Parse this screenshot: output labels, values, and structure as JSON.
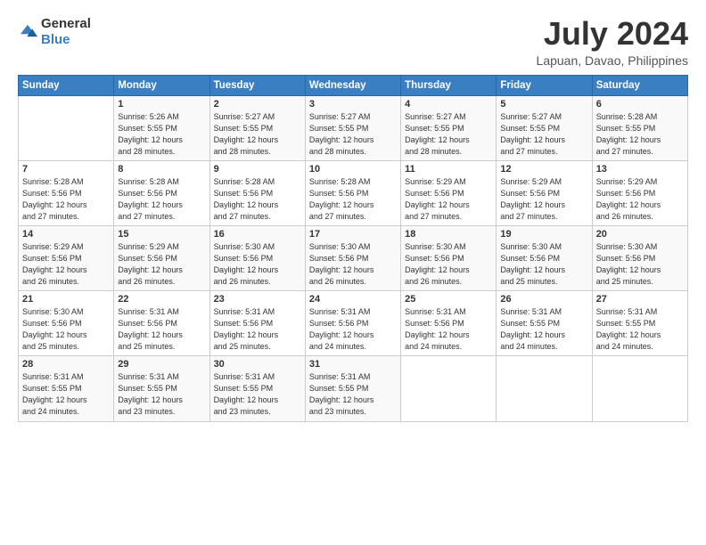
{
  "logo": {
    "general": "General",
    "blue": "Blue"
  },
  "header": {
    "month_year": "July 2024",
    "location": "Lapuan, Davao, Philippines"
  },
  "days_of_week": [
    "Sunday",
    "Monday",
    "Tuesday",
    "Wednesday",
    "Thursday",
    "Friday",
    "Saturday"
  ],
  "weeks": [
    [
      {
        "day": "",
        "info": ""
      },
      {
        "day": "1",
        "info": "Sunrise: 5:26 AM\nSunset: 5:55 PM\nDaylight: 12 hours\nand 28 minutes."
      },
      {
        "day": "2",
        "info": "Sunrise: 5:27 AM\nSunset: 5:55 PM\nDaylight: 12 hours\nand 28 minutes."
      },
      {
        "day": "3",
        "info": "Sunrise: 5:27 AM\nSunset: 5:55 PM\nDaylight: 12 hours\nand 28 minutes."
      },
      {
        "day": "4",
        "info": "Sunrise: 5:27 AM\nSunset: 5:55 PM\nDaylight: 12 hours\nand 28 minutes."
      },
      {
        "day": "5",
        "info": "Sunrise: 5:27 AM\nSunset: 5:55 PM\nDaylight: 12 hours\nand 27 minutes."
      },
      {
        "day": "6",
        "info": "Sunrise: 5:28 AM\nSunset: 5:55 PM\nDaylight: 12 hours\nand 27 minutes."
      }
    ],
    [
      {
        "day": "7",
        "info": "Sunrise: 5:28 AM\nSunset: 5:56 PM\nDaylight: 12 hours\nand 27 minutes."
      },
      {
        "day": "8",
        "info": "Sunrise: 5:28 AM\nSunset: 5:56 PM\nDaylight: 12 hours\nand 27 minutes."
      },
      {
        "day": "9",
        "info": "Sunrise: 5:28 AM\nSunset: 5:56 PM\nDaylight: 12 hours\nand 27 minutes."
      },
      {
        "day": "10",
        "info": "Sunrise: 5:28 AM\nSunset: 5:56 PM\nDaylight: 12 hours\nand 27 minutes."
      },
      {
        "day": "11",
        "info": "Sunrise: 5:29 AM\nSunset: 5:56 PM\nDaylight: 12 hours\nand 27 minutes."
      },
      {
        "day": "12",
        "info": "Sunrise: 5:29 AM\nSunset: 5:56 PM\nDaylight: 12 hours\nand 27 minutes."
      },
      {
        "day": "13",
        "info": "Sunrise: 5:29 AM\nSunset: 5:56 PM\nDaylight: 12 hours\nand 26 minutes."
      }
    ],
    [
      {
        "day": "14",
        "info": "Sunrise: 5:29 AM\nSunset: 5:56 PM\nDaylight: 12 hours\nand 26 minutes."
      },
      {
        "day": "15",
        "info": "Sunrise: 5:29 AM\nSunset: 5:56 PM\nDaylight: 12 hours\nand 26 minutes."
      },
      {
        "day": "16",
        "info": "Sunrise: 5:30 AM\nSunset: 5:56 PM\nDaylight: 12 hours\nand 26 minutes."
      },
      {
        "day": "17",
        "info": "Sunrise: 5:30 AM\nSunset: 5:56 PM\nDaylight: 12 hours\nand 26 minutes."
      },
      {
        "day": "18",
        "info": "Sunrise: 5:30 AM\nSunset: 5:56 PM\nDaylight: 12 hours\nand 26 minutes."
      },
      {
        "day": "19",
        "info": "Sunrise: 5:30 AM\nSunset: 5:56 PM\nDaylight: 12 hours\nand 25 minutes."
      },
      {
        "day": "20",
        "info": "Sunrise: 5:30 AM\nSunset: 5:56 PM\nDaylight: 12 hours\nand 25 minutes."
      }
    ],
    [
      {
        "day": "21",
        "info": "Sunrise: 5:30 AM\nSunset: 5:56 PM\nDaylight: 12 hours\nand 25 minutes."
      },
      {
        "day": "22",
        "info": "Sunrise: 5:31 AM\nSunset: 5:56 PM\nDaylight: 12 hours\nand 25 minutes."
      },
      {
        "day": "23",
        "info": "Sunrise: 5:31 AM\nSunset: 5:56 PM\nDaylight: 12 hours\nand 25 minutes."
      },
      {
        "day": "24",
        "info": "Sunrise: 5:31 AM\nSunset: 5:56 PM\nDaylight: 12 hours\nand 24 minutes."
      },
      {
        "day": "25",
        "info": "Sunrise: 5:31 AM\nSunset: 5:56 PM\nDaylight: 12 hours\nand 24 minutes."
      },
      {
        "day": "26",
        "info": "Sunrise: 5:31 AM\nSunset: 5:55 PM\nDaylight: 12 hours\nand 24 minutes."
      },
      {
        "day": "27",
        "info": "Sunrise: 5:31 AM\nSunset: 5:55 PM\nDaylight: 12 hours\nand 24 minutes."
      }
    ],
    [
      {
        "day": "28",
        "info": "Sunrise: 5:31 AM\nSunset: 5:55 PM\nDaylight: 12 hours\nand 24 minutes."
      },
      {
        "day": "29",
        "info": "Sunrise: 5:31 AM\nSunset: 5:55 PM\nDaylight: 12 hours\nand 23 minutes."
      },
      {
        "day": "30",
        "info": "Sunrise: 5:31 AM\nSunset: 5:55 PM\nDaylight: 12 hours\nand 23 minutes."
      },
      {
        "day": "31",
        "info": "Sunrise: 5:31 AM\nSunset: 5:55 PM\nDaylight: 12 hours\nand 23 minutes."
      },
      {
        "day": "",
        "info": ""
      },
      {
        "day": "",
        "info": ""
      },
      {
        "day": "",
        "info": ""
      }
    ]
  ]
}
